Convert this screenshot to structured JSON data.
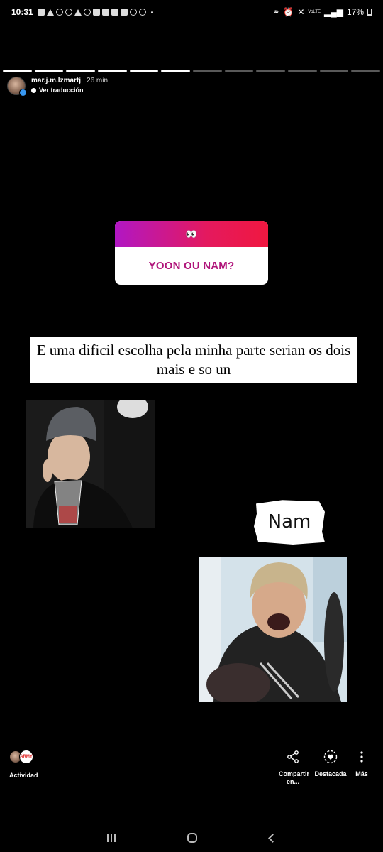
{
  "status_bar": {
    "time": "10:31",
    "battery": "17%",
    "network": "VoLTE"
  },
  "story": {
    "segments_total": 12,
    "segments_viewed": 6,
    "username": "mar.j.m.lzmartj",
    "time_ago": "26 min",
    "translate_label": "Ver traducción"
  },
  "question": {
    "icon": "👀",
    "text": "YOON OU NAM?"
  },
  "reply": {
    "text": "E uma dificil escolha pela minha parte serian os dois mais e so un"
  },
  "sticker": {
    "label": "Nam"
  },
  "bottom": {
    "activity_label": "Actividad",
    "share_label": "Compartir en...",
    "featured_label": "Destacada",
    "more_label": "Más",
    "badge_text": "ARMY"
  },
  "colors": {
    "question_gradient_start": "#b117c4",
    "question_gradient_end": "#f01840",
    "question_text": "#b0147a"
  }
}
